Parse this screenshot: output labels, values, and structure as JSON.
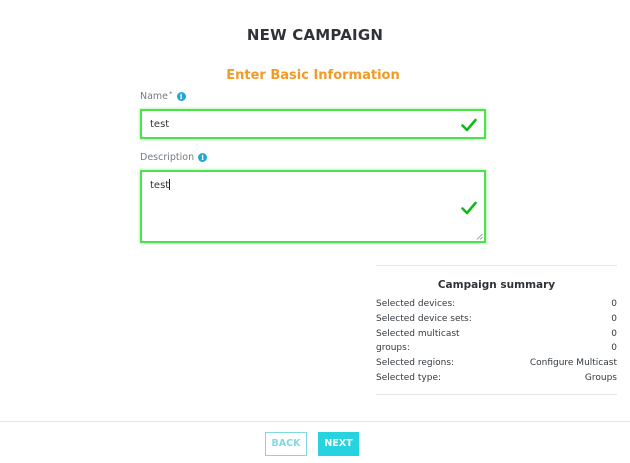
{
  "page": {
    "title": "NEW CAMPAIGN"
  },
  "section": {
    "title": "Enter Basic Information"
  },
  "form": {
    "name": {
      "label": "Name",
      "required_mark": "*",
      "value": "test"
    },
    "description": {
      "label": "Description",
      "value": "test"
    }
  },
  "summary": {
    "title": "Campaign summary",
    "rows": [
      {
        "label": "Selected devices:",
        "value": "0"
      },
      {
        "label": "Selected device sets:",
        "value": "0"
      },
      {
        "label": "Selected multicast",
        "value": "0"
      },
      {
        "label": "groups:",
        "value": "0"
      },
      {
        "label": "Selected regions:",
        "value": "Configure Multicast"
      },
      {
        "label": "Selected type:",
        "value": "Groups"
      }
    ]
  },
  "footer": {
    "back_label": "BACK",
    "next_label": "NEXT"
  },
  "icons": {
    "info": "info-icon",
    "valid": "check-icon"
  },
  "colors": {
    "accent": "#f39a26",
    "valid": "#4ce34a",
    "primary_button": "#27d3de",
    "info": "#1fa8d2"
  }
}
